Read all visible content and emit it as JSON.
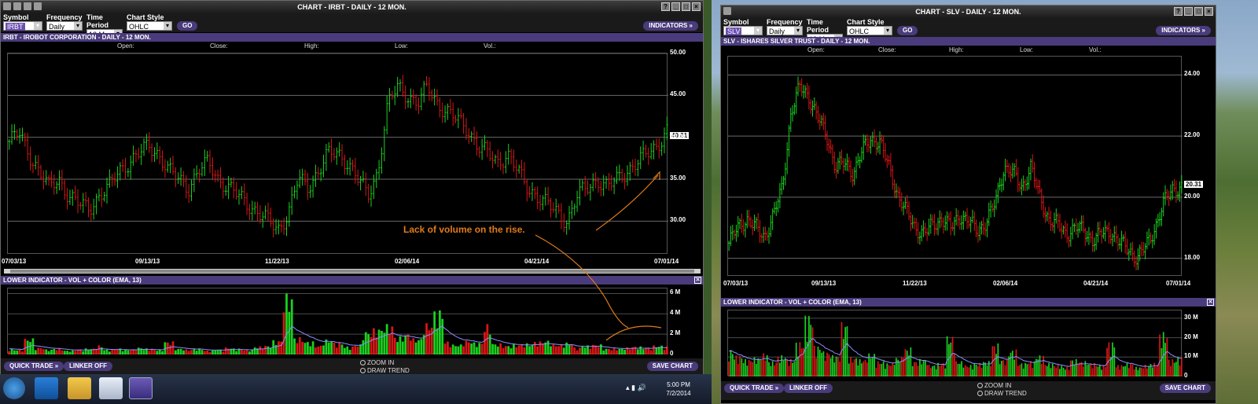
{
  "left": {
    "window_title": "CHART - IRBT - DAILY - 12 MON.",
    "toolbar": {
      "symbol_label": "Symbol",
      "symbol_value": "IRBT",
      "frequency_label": "Frequency",
      "frequency_value": "Daily",
      "period_label": "Time Period",
      "period_value": "12 Mon",
      "style_label": "Chart Style",
      "style_value": "OHLC",
      "go_label": "GO",
      "indicators_label": "INDICATORS »"
    },
    "chart_title": "IRBT - IROBOT CORPORATION - DAILY - 12 MON.",
    "ohlc_labels": [
      "Open:",
      "Close:",
      "High:",
      "Low:",
      "Vol.:"
    ],
    "price_box": "40.81",
    "annotation": "Lack of volume on the rise.",
    "lower_title": "LOWER INDICATOR - VOL + COLOR (EMA, 13)",
    "close_x": "✕",
    "quick_trade": "QUICK TRADE »",
    "linker_off": "LINKER OFF",
    "zoom_in": "ZOOM IN",
    "draw_trend": "DRAW TREND",
    "save_chart": "SAVE CHART"
  },
  "right": {
    "window_title": "CHART - SLV - DAILY - 12 MON.",
    "toolbar": {
      "symbol_label": "Symbol",
      "symbol_value": "SLV",
      "frequency_label": "Frequency",
      "frequency_value": "Daily",
      "period_label": "Time Period",
      "period_value": "12 Mon.",
      "style_label": "Chart Style",
      "style_value": "OHLC",
      "go_label": "GO",
      "indicators_label": "INDICATORS »"
    },
    "chart_title": "SLV - ISHARES SILVER TRUST - DAILY - 12 MON.",
    "ohlc_labels": [
      "Open:",
      "Close:",
      "High:",
      "Low:",
      "Vol.:"
    ],
    "price_box": "20.31",
    "lower_title": "LOWER INDICATOR - VOL + COLOR (EMA, 13)",
    "close_x": "✕",
    "quick_trade": "QUICK TRADE »",
    "linker_off": "LINKER OFF",
    "zoom_in": "ZOOM IN",
    "draw_trend": "DRAW TREND",
    "save_chart": "SAVE CHART"
  },
  "taskbar": {
    "time": "5:00 PM",
    "date": "7/2/2014"
  },
  "chart_data": [
    {
      "type": "ohlc",
      "symbol": "IRBT",
      "x_ticks": [
        "07/03/13",
        "09/13/13",
        "11/22/13",
        "02/06/14",
        "04/21/14",
        "07/01/14"
      ],
      "y_ticks": [
        "50.00",
        "45.00",
        "40.00",
        "35.00",
        "30.00"
      ],
      "ylim": [
        26,
        50
      ],
      "grid": true,
      "close_series": [
        39.5,
        40.5,
        38,
        36,
        34,
        35,
        33,
        32,
        31.5,
        33,
        34,
        36,
        37,
        38,
        39,
        38,
        36,
        35,
        34,
        36,
        37,
        35,
        34,
        33,
        32,
        31,
        30,
        29,
        31,
        35,
        34,
        36,
        38,
        38,
        37,
        35,
        33,
        36,
        44,
        46,
        45,
        44,
        46,
        44,
        43,
        42,
        41,
        39,
        38,
        37,
        38,
        36,
        34,
        33,
        32,
        31,
        30,
        33,
        34,
        35,
        34,
        35,
        36,
        37,
        38,
        39,
        40.8
      ],
      "last_price": "40.81"
    },
    {
      "type": "bar",
      "title": "LOWER INDICATOR - VOL + COLOR (EMA, 13)",
      "symbol": "IRBT",
      "y_ticks": [
        "6 M",
        "4 M",
        "2 M",
        "0"
      ],
      "ylim": [
        0,
        6.5
      ],
      "volume_series": [
        0.6,
        0.5,
        1.6,
        0.7,
        0.5,
        0.6,
        0.4,
        0.5,
        0.6,
        0.9,
        0.5,
        0.6,
        0.5,
        0.7,
        0.6,
        0.5,
        1.3,
        0.6,
        0.5,
        0.6,
        0.4,
        0.5,
        0.7,
        0.6,
        0.5,
        0.8,
        0.9,
        1.4,
        6.0,
        1.7,
        1.3,
        0.9,
        1.5,
        1.2,
        0.8,
        1.0,
        2.3,
        2.6,
        3.0,
        1.8,
        2.1,
        1.6,
        3.1,
        4.4,
        1.3,
        1.0,
        1.4,
        1.2,
        3.0,
        1.1,
        0.9,
        1.0,
        1.1,
        1.3,
        1.4,
        1.0,
        1.2,
        0.7,
        0.9,
        1.0,
        0.6,
        0.6,
        0.7,
        0.8,
        0.7,
        0.9,
        0.8
      ]
    },
    {
      "type": "ohlc",
      "symbol": "SLV",
      "x_ticks": [
        "07/03/13",
        "09/13/13",
        "11/22/13",
        "02/06/14",
        "04/21/14",
        "07/01/14"
      ],
      "y_ticks": [
        "24.00",
        "22.00",
        "20.00",
        "18.00"
      ],
      "ylim": [
        17.4,
        24.6
      ],
      "grid": true,
      "close_series": [
        18.5,
        19.0,
        19.3,
        19.0,
        18.7,
        19.4,
        20.3,
        22.8,
        23.6,
        23.3,
        22.6,
        22.0,
        21.0,
        21.1,
        20.8,
        21.5,
        21.9,
        21.8,
        21.0,
        20.1,
        19.5,
        19.0,
        18.8,
        19.1,
        19.3,
        19.0,
        19.4,
        19.2,
        18.9,
        19.2,
        19.8,
        21.0,
        20.8,
        20.3,
        21.0,
        20.0,
        19.3,
        19.1,
        18.8,
        19.0,
        18.9,
        18.6,
        18.8,
        18.9,
        18.5,
        18.3,
        18.0,
        18.4,
        19.0,
        19.8,
        20.3,
        20.3
      ],
      "last_price": "20.31"
    },
    {
      "type": "bar",
      "title": "LOWER INDICATOR - VOL + COLOR (EMA, 13)",
      "symbol": "SLV",
      "y_ticks": [
        "30 M",
        "20 M",
        "10 M",
        "0"
      ],
      "ylim": [
        0,
        34
      ],
      "volume_series": [
        14,
        11,
        9,
        10,
        12,
        8,
        11,
        9,
        18,
        32,
        16,
        13,
        11,
        28,
        10,
        9,
        12,
        8,
        7,
        10,
        15,
        8,
        9,
        6,
        7,
        21,
        8,
        6,
        7,
        8,
        17,
        9,
        14,
        7,
        8,
        11,
        7,
        6,
        5,
        9,
        8,
        7,
        6,
        18,
        6,
        7,
        5,
        6,
        7,
        23,
        9,
        10
      ]
    }
  ]
}
